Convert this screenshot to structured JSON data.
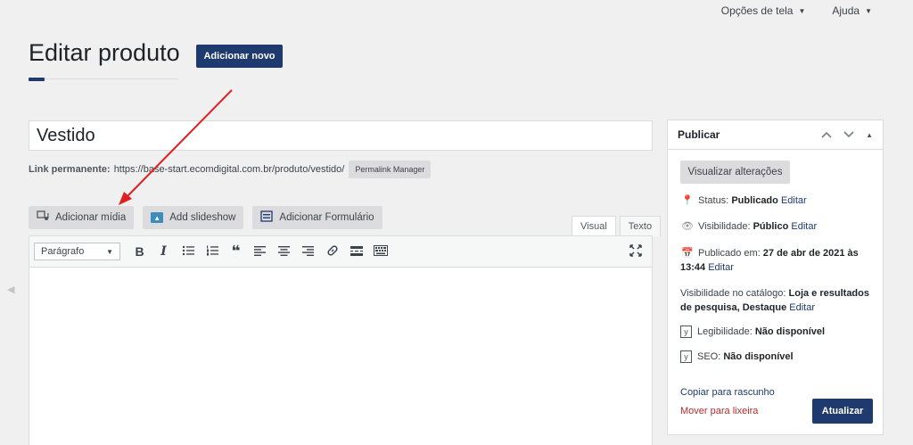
{
  "top_links": {
    "screen_options": "Opções de tela",
    "help": "Ajuda",
    "caret": "▼"
  },
  "page": {
    "title": "Editar produto",
    "add_new": "Adicionar novo"
  },
  "post_title": {
    "value": "Vestido"
  },
  "permalink": {
    "label": "Link permanente:",
    "url": "https://base-start.ecomdigital.com.br/produto/vestido/",
    "manager_button": "Permalink Manager"
  },
  "media_buttons": {
    "add_media": "Adicionar mídia",
    "add_slideshow": "Add slideshow",
    "add_form": "Adicionar Formulário"
  },
  "editor_tabs": {
    "visual": "Visual",
    "text": "Texto"
  },
  "toolbar": {
    "format": "Parágrafo",
    "format_caret": "▼",
    "bold": "B",
    "italic": "I"
  },
  "publish_box": {
    "title": "Publicar",
    "preview_button": "Visualizar alterações",
    "status_label": "Status:",
    "status_value": "Publicado",
    "edit": "Editar",
    "visibility_label": "Visibilidade:",
    "visibility_value": "Público",
    "published_label": "Publicado em:",
    "published_value_1": "27 de abr de 2021 às",
    "published_value_2": "13:44",
    "catalog_label": "Visibilidade no catálogo:",
    "catalog_value_1": "Loja e resultados",
    "catalog_value_2": "de pesquisa, Destaque",
    "readability_label": "Legibilidade:",
    "readability_value": "Não disponível",
    "seo_label": "SEO:",
    "seo_value": "Não disponível",
    "copy_draft": "Copiar para rascunho",
    "trash": "Mover para lixeira",
    "update_button": "Atualizar"
  },
  "colors": {
    "primary": "#1e3a6e",
    "annotation_arrow": "#e02020",
    "trash": "#b32d2e"
  }
}
